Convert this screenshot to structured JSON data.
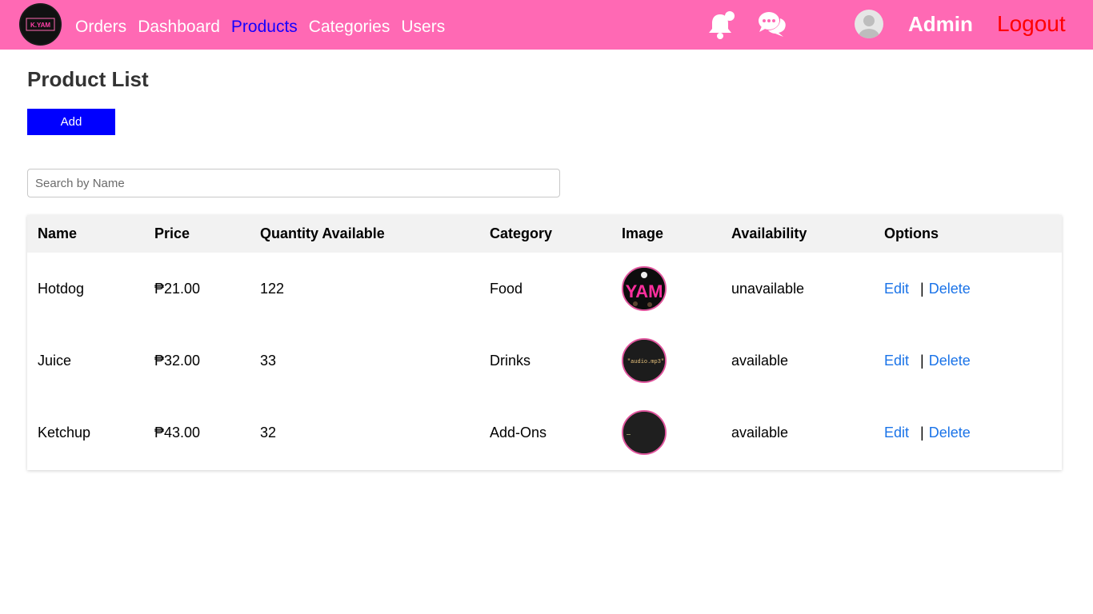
{
  "app": {
    "logo_text": "K.YAM",
    "nav": [
      {
        "label": "Orders",
        "active": false
      },
      {
        "label": "Dashboard",
        "active": false
      },
      {
        "label": "Products",
        "active": true
      },
      {
        "label": "Categories",
        "active": false
      },
      {
        "label": "Users",
        "active": false
      }
    ],
    "icons": [
      "bell-icon",
      "chat-icon",
      "user-avatar-icon"
    ],
    "admin_label": "Admin",
    "logout_label": "Logout",
    "colors": {
      "header_bg": "#ff69b4",
      "nav_active": "#1400ff",
      "logout": "#ff0000",
      "add_button": "#0000ff",
      "link": "#1a73e8"
    }
  },
  "page": {
    "title": "Product List",
    "add_label": "Add",
    "search_placeholder": "Search by Name",
    "search_value": ""
  },
  "table": {
    "columns": [
      "Name",
      "Price",
      "Quantity Available",
      "Category",
      "Image",
      "Availability",
      "Options"
    ],
    "rows": [
      {
        "name": "Hotdog",
        "price": "₱21.00",
        "quantity": "122",
        "category": "Food",
        "image": "YAM",
        "availability": "unavailable"
      },
      {
        "name": "Juice",
        "price": "₱32.00",
        "quantity": "33",
        "category": "Drinks",
        "image": "\"audio.mp3\"",
        "availability": "available"
      },
      {
        "name": "Ketchup",
        "price": "₱43.00",
        "quantity": "32",
        "category": "Add-Ons",
        "image": "",
        "availability": "available"
      }
    ],
    "edit_label": "Edit",
    "separator": "|",
    "delete_label": "Delete"
  }
}
